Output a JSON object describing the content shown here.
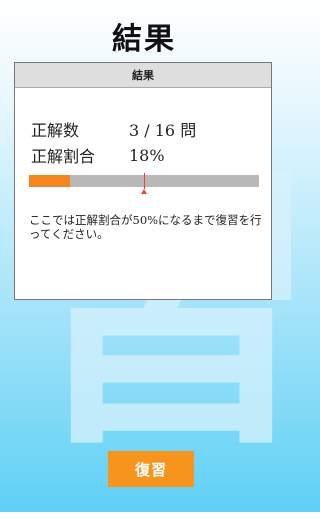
{
  "page_title": "結果",
  "card": {
    "header": "結果",
    "correct_count_label": "正解数",
    "correct_count_value": "3 / 16 問",
    "correct_rate_label": "正解割合",
    "correct_rate_value": "18%",
    "progress_fraction": 0.18,
    "target_fraction": 0.5,
    "note": "ここでは正解割合が50%になるまで復習を行ってください。"
  },
  "review_button_label": "復習",
  "colors": {
    "progress_fill": "#f5851f",
    "progress_track": "#b9b9b9",
    "target_marker": "#ff3b30",
    "button": "#f7941d"
  }
}
